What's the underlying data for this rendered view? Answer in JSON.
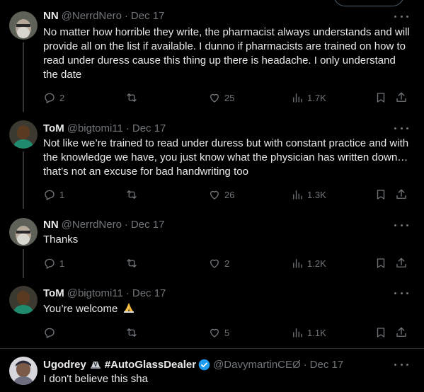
{
  "posts": [
    {
      "name": "NN",
      "handle": "@NerrdNero",
      "sep": "·",
      "date": "Dec 17",
      "text": "No matter how horrible they write, the pharmacist always understands and will provide all on the list if available. I dunno if pharmacists are trained on how to read under duress cause this thing up there is headache. I only understand the date",
      "replies": "2",
      "reposts": "",
      "likes": "25",
      "views": "1.7K",
      "avatar_color": "#6b6e66"
    },
    {
      "name": "ToM",
      "handle": "@bigtomi11",
      "sep": "·",
      "date": "Dec 17",
      "text": "Not like we’re trained to read under duress but with constant practice and with the knowledge we have, you just know what the physician has written down… that’s not an excuse for bad handwriting too",
      "replies": "1",
      "reposts": "",
      "likes": "26",
      "views": "1.3K",
      "avatar_color": "#2f7d6a"
    },
    {
      "name": "NN",
      "handle": "@NerrdNero",
      "sep": "·",
      "date": "Dec 17",
      "text": "Thanks",
      "replies": "1",
      "reposts": "",
      "likes": "2",
      "views": "1.2K",
      "avatar_color": "#6b6e66"
    },
    {
      "name": "ToM",
      "handle": "@bigtomi11",
      "sep": "·",
      "date": "Dec 17",
      "text": "You’re welcome",
      "replies": "",
      "reposts": "",
      "likes": "5",
      "views": "1.1K",
      "avatar_color": "#2f7d6a"
    },
    {
      "name": "Ugodrey",
      "name_tag": "#AutoGlassDealer",
      "handle": "@DavymartinCEØ",
      "sep": "·",
      "date": "Dec 17",
      "text": "I don't believe this sha",
      "avatar_color": "#8a8c93"
    }
  ],
  "icons": {
    "reply": "reply-icon",
    "repost": "repost-icon",
    "like": "heart-icon",
    "views": "views-icon",
    "bookmark": "bookmark-icon",
    "share": "share-icon",
    "more": "more-icon"
  },
  "colors": {
    "background": "#000000",
    "text": "#e7e9ea",
    "muted": "#71767b",
    "verified": "#1d9bf0"
  }
}
